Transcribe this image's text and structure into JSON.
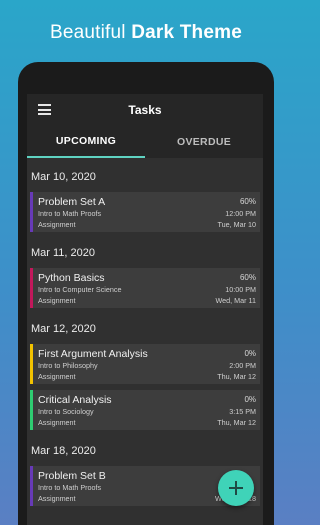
{
  "promo": {
    "prefix": "Beautiful",
    "emphasis": "Dark Theme"
  },
  "appbar": {
    "title": "Tasks"
  },
  "tabs": [
    {
      "label": "UPCOMING"
    },
    {
      "label": "OVERDUE"
    }
  ],
  "groups": [
    {
      "date": "Mar 10, 2020",
      "tasks": [
        {
          "title": "Problem Set A",
          "percent": "60%",
          "course": "Intro to Math Proofs",
          "time": "12:00 PM",
          "type": "Assignment",
          "due": "Tue, Mar 10",
          "color": "#673ab7"
        }
      ]
    },
    {
      "date": "Mar 11, 2020",
      "tasks": [
        {
          "title": "Python Basics",
          "percent": "60%",
          "course": "Intro to Computer Science",
          "time": "10:00 PM",
          "type": "Assignment",
          "due": "Wed, Mar 11",
          "color": "#c2185b"
        }
      ]
    },
    {
      "date": "Mar 12, 2020",
      "tasks": [
        {
          "title": "First Argument Analysis",
          "percent": "0%",
          "course": "Intro to Philosophy",
          "time": "2:00 PM",
          "type": "Assignment",
          "due": "Thu, Mar 12",
          "color": "#f2c200"
        },
        {
          "title": "Critical Analysis",
          "percent": "0%",
          "course": "Intro to Sociology",
          "time": "3:15 PM",
          "type": "Assignment",
          "due": "Thu, Mar 12",
          "color": "#2ecc71"
        }
      ]
    },
    {
      "date": "Mar 18, 2020",
      "tasks": [
        {
          "title": "Problem Set B",
          "percent": "",
          "course": "Intro to Math Proofs",
          "time": "",
          "type": "Assignment",
          "due": "Wed, Mar 18",
          "color": "#673ab7"
        }
      ]
    }
  ],
  "icons": {
    "menu": "menu-icon",
    "fab": "plus-icon"
  },
  "colors": {
    "accent": "#5fd3c2",
    "fab": "#3fd3b8"
  }
}
